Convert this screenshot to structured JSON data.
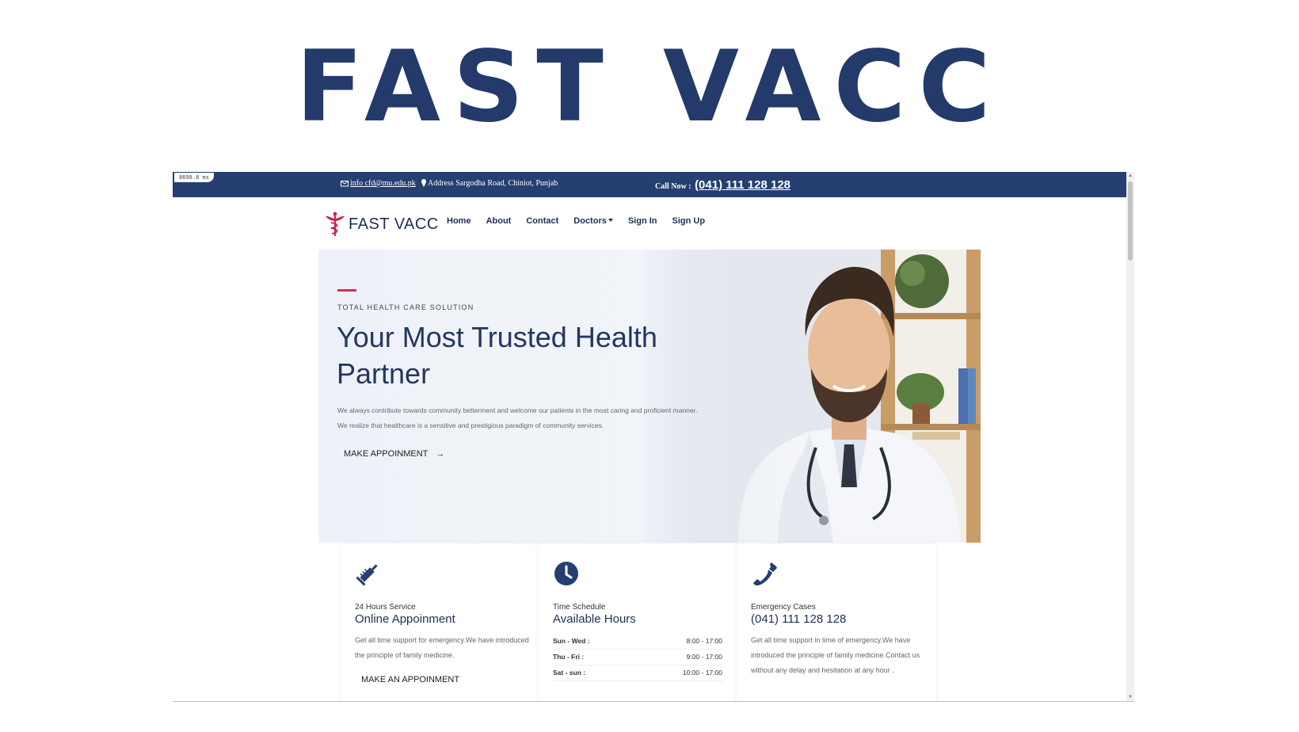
{
  "slide": {
    "title": "FAST VACC"
  },
  "perf_overlay": "8698.8 ms",
  "topbar": {
    "email": "info cfd@mu.edu.pk",
    "address": "Address Sargodha Road, Chiniot, Punjab",
    "call_label": "Call Now :",
    "phone": "(041) 111 128 128",
    "background": "#253f70"
  },
  "brand": {
    "name": "FAST VACC",
    "logo_icon": "caduceus-icon",
    "accent_color": "#d62d56",
    "primary_color": "#24375f"
  },
  "nav": {
    "items": [
      {
        "label": "Home"
      },
      {
        "label": "About"
      },
      {
        "label": "Contact"
      },
      {
        "label": "Doctors"
      },
      {
        "label": "Sign In"
      },
      {
        "label": "Sign Up"
      }
    ]
  },
  "hero": {
    "subtitle": "TOTAL HEALTH CARE SOLUTION",
    "title": "Your Most Trusted Health Partner",
    "description": "We always contribute towards community betterment and welcome our patients in the most caring and proficient manner. We realize that healthcare is a sensitive and prestigious paradigm of community services.",
    "button": "MAKE APPOINMENT"
  },
  "cards": [
    {
      "icon": "syringe-icon",
      "kicker": "24 Hours Service",
      "heading": "Online Appoinment",
      "body": "Get all time support for emergency.We have introduced the principle of family medicine.",
      "button": "MAKE AN APPOINMENT"
    },
    {
      "icon": "clock-icon",
      "kicker": "Time Schedule",
      "heading": "Available Hours",
      "hours": [
        {
          "days": "Sun - Wed :",
          "time": "8:00 - 17:00"
        },
        {
          "days": "Thu - Fri :",
          "time": "9:00 - 17:00"
        },
        {
          "days": "Sat - sun :",
          "time": "10:00 - 17:00"
        }
      ]
    },
    {
      "icon": "phone-icon",
      "kicker": "Emergency Cases",
      "heading": "(041) 111 128 128",
      "body": "Get all time support in time of emergency.We have introduced the principle of family medicine.Contact us without any delay and hesitation at any hour ."
    }
  ]
}
